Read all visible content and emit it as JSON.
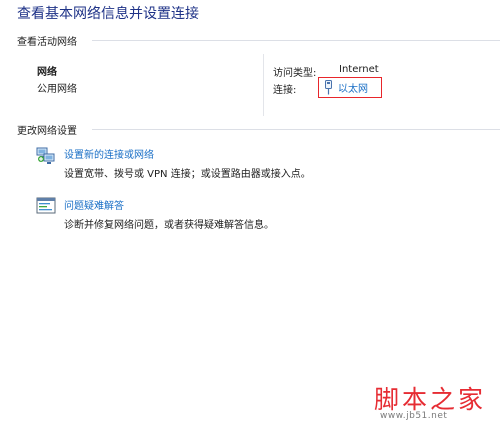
{
  "page": {
    "title": "查看基本网络信息并设置连接"
  },
  "active_networks": {
    "header": "查看活动网络",
    "network_name": "网络",
    "network_type": "公用网络",
    "access_type_label": "访问类型:",
    "access_type_value": "Internet",
    "connections_label": "连接:",
    "connection_name": "以太网",
    "connection_icon": "ethernet-icon",
    "highlight_color": "#e8262b"
  },
  "change_settings": {
    "header": "更改网络设置",
    "tasks": [
      {
        "icon": "network-setup-icon",
        "link": "设置新的连接或网络",
        "description": "设置宽带、拨号或 VPN 连接；或设置路由器或接入点。"
      },
      {
        "icon": "troubleshoot-icon",
        "link": "问题疑难解答",
        "description": "诊断并修复网络问题，或者获得疑难解答信息。"
      }
    ]
  },
  "watermark": {
    "text": "脚本之家",
    "url": "www.jb51.net",
    "color": "#e62c33"
  },
  "colors": {
    "title": "#1e3287",
    "link": "#1a6fc6"
  }
}
